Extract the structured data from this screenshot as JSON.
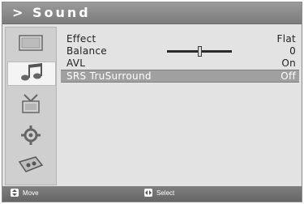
{
  "window": {
    "title": "> Sound"
  },
  "sidebar": {
    "items": [
      {
        "icon": "picture-icon"
      },
      {
        "icon": "sound-note-icon",
        "active": true
      },
      {
        "icon": "channel-antenna-icon"
      },
      {
        "icon": "setup-gear-icon"
      },
      {
        "icon": "input-source-icon"
      }
    ]
  },
  "menu": {
    "rows": [
      {
        "label": "Effect",
        "value": "Flat"
      },
      {
        "label": "Balance",
        "value": "0",
        "slider_level": 0.5
      },
      {
        "label": "AVL",
        "value": "On"
      },
      {
        "label": "SRS TruSurround",
        "value": "Off",
        "selected": true
      }
    ]
  },
  "footer": {
    "move_label": "Move",
    "select_label": "Select"
  },
  "colors": {
    "title_bar": "#8a8a8a",
    "panel": "#e3e3e3",
    "selected_row": "#a0a0a0"
  }
}
